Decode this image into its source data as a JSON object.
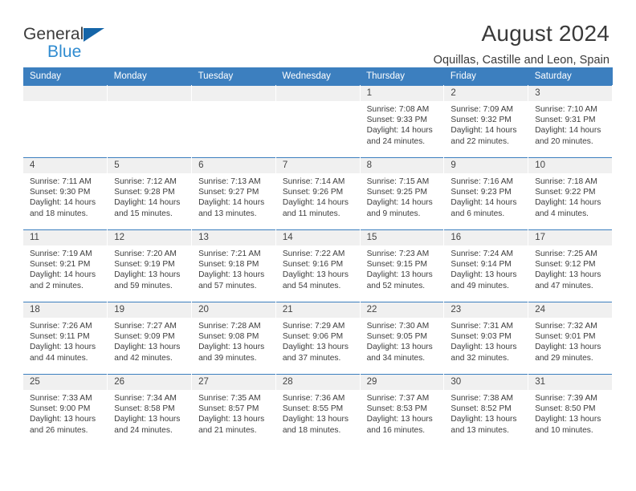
{
  "brand": {
    "name_part1": "General",
    "name_part2": "Blue",
    "triangle_color": "#1565a8",
    "blue_color": "#2f8bd0"
  },
  "header": {
    "title": "August 2024",
    "location": "Oquillas, Castille and Leon, Spain"
  },
  "theme": {
    "header_bar": "#3c7fbf",
    "daynum_bar": "#f0f0f0",
    "text": "#3d3d3d"
  },
  "weekdays": [
    "Sunday",
    "Monday",
    "Tuesday",
    "Wednesday",
    "Thursday",
    "Friday",
    "Saturday"
  ],
  "weeks": [
    [
      {
        "day": "",
        "sunrise": "",
        "sunset": "",
        "daylight1": "",
        "daylight2": ""
      },
      {
        "day": "",
        "sunrise": "",
        "sunset": "",
        "daylight1": "",
        "daylight2": ""
      },
      {
        "day": "",
        "sunrise": "",
        "sunset": "",
        "daylight1": "",
        "daylight2": ""
      },
      {
        "day": "",
        "sunrise": "",
        "sunset": "",
        "daylight1": "",
        "daylight2": ""
      },
      {
        "day": "1",
        "sunrise": "Sunrise: 7:08 AM",
        "sunset": "Sunset: 9:33 PM",
        "daylight1": "Daylight: 14 hours",
        "daylight2": "and 24 minutes."
      },
      {
        "day": "2",
        "sunrise": "Sunrise: 7:09 AM",
        "sunset": "Sunset: 9:32 PM",
        "daylight1": "Daylight: 14 hours",
        "daylight2": "and 22 minutes."
      },
      {
        "day": "3",
        "sunrise": "Sunrise: 7:10 AM",
        "sunset": "Sunset: 9:31 PM",
        "daylight1": "Daylight: 14 hours",
        "daylight2": "and 20 minutes."
      }
    ],
    [
      {
        "day": "4",
        "sunrise": "Sunrise: 7:11 AM",
        "sunset": "Sunset: 9:30 PM",
        "daylight1": "Daylight: 14 hours",
        "daylight2": "and 18 minutes."
      },
      {
        "day": "5",
        "sunrise": "Sunrise: 7:12 AM",
        "sunset": "Sunset: 9:28 PM",
        "daylight1": "Daylight: 14 hours",
        "daylight2": "and 15 minutes."
      },
      {
        "day": "6",
        "sunrise": "Sunrise: 7:13 AM",
        "sunset": "Sunset: 9:27 PM",
        "daylight1": "Daylight: 14 hours",
        "daylight2": "and 13 minutes."
      },
      {
        "day": "7",
        "sunrise": "Sunrise: 7:14 AM",
        "sunset": "Sunset: 9:26 PM",
        "daylight1": "Daylight: 14 hours",
        "daylight2": "and 11 minutes."
      },
      {
        "day": "8",
        "sunrise": "Sunrise: 7:15 AM",
        "sunset": "Sunset: 9:25 PM",
        "daylight1": "Daylight: 14 hours",
        "daylight2": "and 9 minutes."
      },
      {
        "day": "9",
        "sunrise": "Sunrise: 7:16 AM",
        "sunset": "Sunset: 9:23 PM",
        "daylight1": "Daylight: 14 hours",
        "daylight2": "and 6 minutes."
      },
      {
        "day": "10",
        "sunrise": "Sunrise: 7:18 AM",
        "sunset": "Sunset: 9:22 PM",
        "daylight1": "Daylight: 14 hours",
        "daylight2": "and 4 minutes."
      }
    ],
    [
      {
        "day": "11",
        "sunrise": "Sunrise: 7:19 AM",
        "sunset": "Sunset: 9:21 PM",
        "daylight1": "Daylight: 14 hours",
        "daylight2": "and 2 minutes."
      },
      {
        "day": "12",
        "sunrise": "Sunrise: 7:20 AM",
        "sunset": "Sunset: 9:19 PM",
        "daylight1": "Daylight: 13 hours",
        "daylight2": "and 59 minutes."
      },
      {
        "day": "13",
        "sunrise": "Sunrise: 7:21 AM",
        "sunset": "Sunset: 9:18 PM",
        "daylight1": "Daylight: 13 hours",
        "daylight2": "and 57 minutes."
      },
      {
        "day": "14",
        "sunrise": "Sunrise: 7:22 AM",
        "sunset": "Sunset: 9:16 PM",
        "daylight1": "Daylight: 13 hours",
        "daylight2": "and 54 minutes."
      },
      {
        "day": "15",
        "sunrise": "Sunrise: 7:23 AM",
        "sunset": "Sunset: 9:15 PM",
        "daylight1": "Daylight: 13 hours",
        "daylight2": "and 52 minutes."
      },
      {
        "day": "16",
        "sunrise": "Sunrise: 7:24 AM",
        "sunset": "Sunset: 9:14 PM",
        "daylight1": "Daylight: 13 hours",
        "daylight2": "and 49 minutes."
      },
      {
        "day": "17",
        "sunrise": "Sunrise: 7:25 AM",
        "sunset": "Sunset: 9:12 PM",
        "daylight1": "Daylight: 13 hours",
        "daylight2": "and 47 minutes."
      }
    ],
    [
      {
        "day": "18",
        "sunrise": "Sunrise: 7:26 AM",
        "sunset": "Sunset: 9:11 PM",
        "daylight1": "Daylight: 13 hours",
        "daylight2": "and 44 minutes."
      },
      {
        "day": "19",
        "sunrise": "Sunrise: 7:27 AM",
        "sunset": "Sunset: 9:09 PM",
        "daylight1": "Daylight: 13 hours",
        "daylight2": "and 42 minutes."
      },
      {
        "day": "20",
        "sunrise": "Sunrise: 7:28 AM",
        "sunset": "Sunset: 9:08 PM",
        "daylight1": "Daylight: 13 hours",
        "daylight2": "and 39 minutes."
      },
      {
        "day": "21",
        "sunrise": "Sunrise: 7:29 AM",
        "sunset": "Sunset: 9:06 PM",
        "daylight1": "Daylight: 13 hours",
        "daylight2": "and 37 minutes."
      },
      {
        "day": "22",
        "sunrise": "Sunrise: 7:30 AM",
        "sunset": "Sunset: 9:05 PM",
        "daylight1": "Daylight: 13 hours",
        "daylight2": "and 34 minutes."
      },
      {
        "day": "23",
        "sunrise": "Sunrise: 7:31 AM",
        "sunset": "Sunset: 9:03 PM",
        "daylight1": "Daylight: 13 hours",
        "daylight2": "and 32 minutes."
      },
      {
        "day": "24",
        "sunrise": "Sunrise: 7:32 AM",
        "sunset": "Sunset: 9:01 PM",
        "daylight1": "Daylight: 13 hours",
        "daylight2": "and 29 minutes."
      }
    ],
    [
      {
        "day": "25",
        "sunrise": "Sunrise: 7:33 AM",
        "sunset": "Sunset: 9:00 PM",
        "daylight1": "Daylight: 13 hours",
        "daylight2": "and 26 minutes."
      },
      {
        "day": "26",
        "sunrise": "Sunrise: 7:34 AM",
        "sunset": "Sunset: 8:58 PM",
        "daylight1": "Daylight: 13 hours",
        "daylight2": "and 24 minutes."
      },
      {
        "day": "27",
        "sunrise": "Sunrise: 7:35 AM",
        "sunset": "Sunset: 8:57 PM",
        "daylight1": "Daylight: 13 hours",
        "daylight2": "and 21 minutes."
      },
      {
        "day": "28",
        "sunrise": "Sunrise: 7:36 AM",
        "sunset": "Sunset: 8:55 PM",
        "daylight1": "Daylight: 13 hours",
        "daylight2": "and 18 minutes."
      },
      {
        "day": "29",
        "sunrise": "Sunrise: 7:37 AM",
        "sunset": "Sunset: 8:53 PM",
        "daylight1": "Daylight: 13 hours",
        "daylight2": "and 16 minutes."
      },
      {
        "day": "30",
        "sunrise": "Sunrise: 7:38 AM",
        "sunset": "Sunset: 8:52 PM",
        "daylight1": "Daylight: 13 hours",
        "daylight2": "and 13 minutes."
      },
      {
        "day": "31",
        "sunrise": "Sunrise: 7:39 AM",
        "sunset": "Sunset: 8:50 PM",
        "daylight1": "Daylight: 13 hours",
        "daylight2": "and 10 minutes."
      }
    ]
  ]
}
